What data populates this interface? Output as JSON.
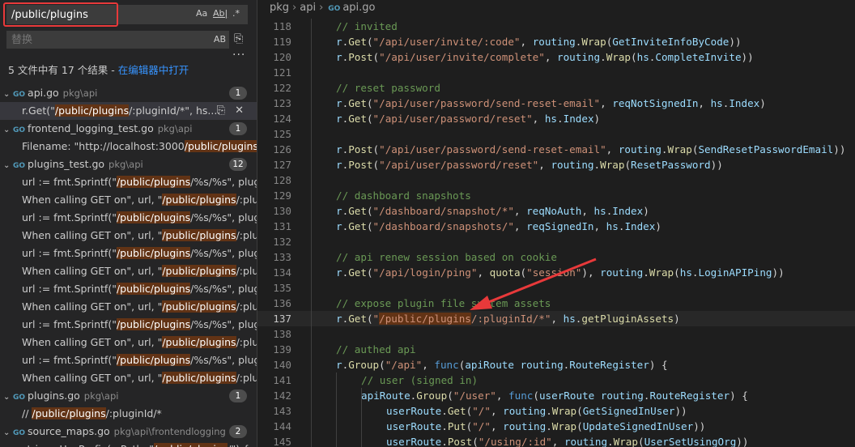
{
  "search": {
    "query": "/public/plugins",
    "replace_placeholder": "替换",
    "summary_prefix": "5 文件中有 17 个结果 - ",
    "summary_link": "在编辑器中打开",
    "opt_case": "Aa",
    "opt_word": "Ab|",
    "opt_regex": ".*",
    "replace_ab": "AB"
  },
  "results": [
    {
      "name": "api.go",
      "path": "pkg\\api",
      "count": "1",
      "matches": [
        {
          "pre": "r.Get(\"",
          "hit": "/public/plugins",
          "post": "/:pluginId/*\", hs...."
        }
      ]
    },
    {
      "name": "frontend_logging_test.go",
      "path": "pkg\\api",
      "count": "1",
      "matches": [
        {
          "pre": "Filename: \"http://localhost:3000",
          "hit": "/public/plugins",
          "post": "/t..."
        }
      ]
    },
    {
      "name": "plugins_test.go",
      "path": "pkg\\api",
      "count": "12",
      "matches": [
        {
          "pre": "url := fmt.Sprintf(\"",
          "hit": "/public/plugins",
          "post": "/%s/%s\", plugi..."
        },
        {
          "pre": "When calling GET on\", url, \"",
          "hit": "/public/plugins",
          "post": "/:plugi..."
        },
        {
          "pre": "url := fmt.Sprintf(\"",
          "hit": "/public/plugins",
          "post": "/%s/%s\", plugi..."
        },
        {
          "pre": "When calling GET on\", url, \"",
          "hit": "/public/plugins",
          "post": "/:plugi..."
        },
        {
          "pre": "url := fmt.Sprintf(\"",
          "hit": "/public/plugins",
          "post": "/%s/%s\", plugi..."
        },
        {
          "pre": "When calling GET on\", url, \"",
          "hit": "/public/plugins",
          "post": "/:plugi..."
        },
        {
          "pre": "url := fmt.Sprintf(\"",
          "hit": "/public/plugins",
          "post": "/%s/%s\", plugi..."
        },
        {
          "pre": "When calling GET on\", url, \"",
          "hit": "/public/plugins",
          "post": "/:plugi..."
        },
        {
          "pre": "url := fmt.Sprintf(\"",
          "hit": "/public/plugins",
          "post": "/%s/%s\", plugi..."
        },
        {
          "pre": "When calling GET on\", url, \"",
          "hit": "/public/plugins",
          "post": "/:plugi..."
        },
        {
          "pre": "url := fmt.Sprintf(\"",
          "hit": "/public/plugins",
          "post": "/%s/%s\", plugi..."
        },
        {
          "pre": "When calling GET on\", url, \"",
          "hit": "/public/plugins",
          "post": "/:plugi..."
        }
      ]
    },
    {
      "name": "plugins.go",
      "path": "pkg\\api",
      "count": "1",
      "matches": [
        {
          "pre": "// ",
          "hit": "/public/plugins",
          "post": "/:pluginId/*"
        }
      ]
    },
    {
      "name": "source_maps.go",
      "path": "pkg\\api\\frontendlogging",
      "count": "2",
      "matches": [
        {
          "pre": "strings.HasPrefix(u.Path, \"",
          "hit": "/public/plugins",
          "post": "/\") {"
        }
      ]
    }
  ],
  "breadcrumb": [
    "pkg",
    "api",
    "api.go"
  ],
  "code": {
    "active_line": 137,
    "lines": [
      {
        "n": "118",
        "indent": 1,
        "tokens": [
          [
            "c",
            "// invited"
          ]
        ]
      },
      {
        "n": "119",
        "indent": 1,
        "tokens": [
          [
            "v",
            "r"
          ],
          [
            "p",
            "."
          ],
          [
            "f",
            "Get"
          ],
          [
            "p",
            "("
          ],
          [
            "s",
            "\"/api/user/invite/:code\""
          ],
          [
            "p",
            ", "
          ],
          [
            "v",
            "routing"
          ],
          [
            "p",
            "."
          ],
          [
            "f",
            "Wrap"
          ],
          [
            "p",
            "("
          ],
          [
            "v",
            "GetInviteInfoByCode"
          ],
          [
            "p",
            "))"
          ]
        ]
      },
      {
        "n": "120",
        "indent": 1,
        "tokens": [
          [
            "v",
            "r"
          ],
          [
            "p",
            "."
          ],
          [
            "f",
            "Post"
          ],
          [
            "p",
            "("
          ],
          [
            "s",
            "\"/api/user/invite/complete\""
          ],
          [
            "p",
            ", "
          ],
          [
            "v",
            "routing"
          ],
          [
            "p",
            "."
          ],
          [
            "f",
            "Wrap"
          ],
          [
            "p",
            "("
          ],
          [
            "v",
            "hs"
          ],
          [
            "p",
            "."
          ],
          [
            "v",
            "CompleteInvite"
          ],
          [
            "p",
            "))"
          ]
        ]
      },
      {
        "n": "121",
        "indent": 0,
        "tokens": []
      },
      {
        "n": "122",
        "indent": 1,
        "tokens": [
          [
            "c",
            "// reset password"
          ]
        ]
      },
      {
        "n": "123",
        "indent": 1,
        "tokens": [
          [
            "v",
            "r"
          ],
          [
            "p",
            "."
          ],
          [
            "f",
            "Get"
          ],
          [
            "p",
            "("
          ],
          [
            "s",
            "\"/api/user/password/send-reset-email\""
          ],
          [
            "p",
            ", "
          ],
          [
            "v",
            "reqNotSignedIn"
          ],
          [
            "p",
            ", "
          ],
          [
            "v",
            "hs"
          ],
          [
            "p",
            "."
          ],
          [
            "v",
            "Index"
          ],
          [
            "p",
            ")"
          ]
        ]
      },
      {
        "n": "124",
        "indent": 1,
        "tokens": [
          [
            "v",
            "r"
          ],
          [
            "p",
            "."
          ],
          [
            "f",
            "Get"
          ],
          [
            "p",
            "("
          ],
          [
            "s",
            "\"/api/user/password/reset\""
          ],
          [
            "p",
            ", "
          ],
          [
            "v",
            "hs"
          ],
          [
            "p",
            "."
          ],
          [
            "v",
            "Index"
          ],
          [
            "p",
            ")"
          ]
        ]
      },
      {
        "n": "125",
        "indent": 0,
        "tokens": []
      },
      {
        "n": "126",
        "indent": 1,
        "tokens": [
          [
            "v",
            "r"
          ],
          [
            "p",
            "."
          ],
          [
            "f",
            "Post"
          ],
          [
            "p",
            "("
          ],
          [
            "s",
            "\"/api/user/password/send-reset-email\""
          ],
          [
            "p",
            ", "
          ],
          [
            "v",
            "routing"
          ],
          [
            "p",
            "."
          ],
          [
            "f",
            "Wrap"
          ],
          [
            "p",
            "("
          ],
          [
            "v",
            "SendResetPasswordEmail"
          ],
          [
            "p",
            "))"
          ]
        ]
      },
      {
        "n": "127",
        "indent": 1,
        "tokens": [
          [
            "v",
            "r"
          ],
          [
            "p",
            "."
          ],
          [
            "f",
            "Post"
          ],
          [
            "p",
            "("
          ],
          [
            "s",
            "\"/api/user/password/reset\""
          ],
          [
            "p",
            ", "
          ],
          [
            "v",
            "routing"
          ],
          [
            "p",
            "."
          ],
          [
            "f",
            "Wrap"
          ],
          [
            "p",
            "("
          ],
          [
            "v",
            "ResetPassword"
          ],
          [
            "p",
            "))"
          ]
        ]
      },
      {
        "n": "128",
        "indent": 0,
        "tokens": []
      },
      {
        "n": "129",
        "indent": 1,
        "tokens": [
          [
            "c",
            "// dashboard snapshots"
          ]
        ]
      },
      {
        "n": "130",
        "indent": 1,
        "tokens": [
          [
            "v",
            "r"
          ],
          [
            "p",
            "."
          ],
          [
            "f",
            "Get"
          ],
          [
            "p",
            "("
          ],
          [
            "s",
            "\"/dashboard/snapshot/*\""
          ],
          [
            "p",
            ", "
          ],
          [
            "v",
            "reqNoAuth"
          ],
          [
            "p",
            ", "
          ],
          [
            "v",
            "hs"
          ],
          [
            "p",
            "."
          ],
          [
            "v",
            "Index"
          ],
          [
            "p",
            ")"
          ]
        ]
      },
      {
        "n": "131",
        "indent": 1,
        "tokens": [
          [
            "v",
            "r"
          ],
          [
            "p",
            "."
          ],
          [
            "f",
            "Get"
          ],
          [
            "p",
            "("
          ],
          [
            "s",
            "\"/dashboard/snapshots/\""
          ],
          [
            "p",
            ", "
          ],
          [
            "v",
            "reqSignedIn"
          ],
          [
            "p",
            ", "
          ],
          [
            "v",
            "hs"
          ],
          [
            "p",
            "."
          ],
          [
            "v",
            "Index"
          ],
          [
            "p",
            ")"
          ]
        ]
      },
      {
        "n": "132",
        "indent": 0,
        "tokens": []
      },
      {
        "n": "133",
        "indent": 1,
        "tokens": [
          [
            "c",
            "// api renew session based on cookie"
          ]
        ]
      },
      {
        "n": "134",
        "indent": 1,
        "tokens": [
          [
            "v",
            "r"
          ],
          [
            "p",
            "."
          ],
          [
            "f",
            "Get"
          ],
          [
            "p",
            "("
          ],
          [
            "s",
            "\"/api/login/ping\""
          ],
          [
            "p",
            ", "
          ],
          [
            "f",
            "quota"
          ],
          [
            "p",
            "("
          ],
          [
            "s",
            "\"session\""
          ],
          [
            "p",
            "), "
          ],
          [
            "v",
            "routing"
          ],
          [
            "p",
            "."
          ],
          [
            "f",
            "Wrap"
          ],
          [
            "p",
            "("
          ],
          [
            "v",
            "hs"
          ],
          [
            "p",
            "."
          ],
          [
            "v",
            "LoginAPIPing"
          ],
          [
            "p",
            "))"
          ]
        ]
      },
      {
        "n": "135",
        "indent": 0,
        "tokens": []
      },
      {
        "n": "136",
        "indent": 1,
        "tokens": [
          [
            "c",
            "// expose plugin file system assets"
          ]
        ]
      },
      {
        "n": "137",
        "indent": 1,
        "tokens": [
          [
            "v",
            "r"
          ],
          [
            "p",
            "."
          ],
          [
            "f",
            "Get"
          ],
          [
            "p",
            "("
          ],
          [
            "s",
            "\""
          ],
          [
            "h",
            "/public/plugins"
          ],
          [
            "s",
            "/:pluginId/*\""
          ],
          [
            "p",
            ", "
          ],
          [
            "v",
            "hs"
          ],
          [
            "p",
            "."
          ],
          [
            "f",
            "getPluginAssets"
          ],
          [
            "p",
            ")"
          ]
        ]
      },
      {
        "n": "138",
        "indent": 0,
        "tokens": []
      },
      {
        "n": "139",
        "indent": 1,
        "tokens": [
          [
            "c",
            "// authed api"
          ]
        ]
      },
      {
        "n": "140",
        "indent": 1,
        "tokens": [
          [
            "v",
            "r"
          ],
          [
            "p",
            "."
          ],
          [
            "f",
            "Group"
          ],
          [
            "p",
            "("
          ],
          [
            "s",
            "\"/api\""
          ],
          [
            "p",
            ", "
          ],
          [
            "k",
            "func"
          ],
          [
            "p",
            "("
          ],
          [
            "v",
            "apiRoute"
          ],
          [
            "p",
            " "
          ],
          [
            "v",
            "routing"
          ],
          [
            "p",
            "."
          ],
          [
            "v",
            "RouteRegister"
          ],
          [
            "p",
            ") {"
          ]
        ]
      },
      {
        "n": "141",
        "indent": 2,
        "tokens": [
          [
            "c",
            "// user (signed in)"
          ]
        ]
      },
      {
        "n": "142",
        "indent": 2,
        "tokens": [
          [
            "v",
            "apiRoute"
          ],
          [
            "p",
            "."
          ],
          [
            "f",
            "Group"
          ],
          [
            "p",
            "("
          ],
          [
            "s",
            "\"/user\""
          ],
          [
            "p",
            ", "
          ],
          [
            "k",
            "func"
          ],
          [
            "p",
            "("
          ],
          [
            "v",
            "userRoute"
          ],
          [
            "p",
            " "
          ],
          [
            "v",
            "routing"
          ],
          [
            "p",
            "."
          ],
          [
            "v",
            "RouteRegister"
          ],
          [
            "p",
            ") {"
          ]
        ]
      },
      {
        "n": "143",
        "indent": 3,
        "tokens": [
          [
            "v",
            "userRoute"
          ],
          [
            "p",
            "."
          ],
          [
            "f",
            "Get"
          ],
          [
            "p",
            "("
          ],
          [
            "s",
            "\"/\""
          ],
          [
            "p",
            ", "
          ],
          [
            "v",
            "routing"
          ],
          [
            "p",
            "."
          ],
          [
            "f",
            "Wrap"
          ],
          [
            "p",
            "("
          ],
          [
            "v",
            "GetSignedInUser"
          ],
          [
            "p",
            "))"
          ]
        ]
      },
      {
        "n": "144",
        "indent": 3,
        "tokens": [
          [
            "v",
            "userRoute"
          ],
          [
            "p",
            "."
          ],
          [
            "f",
            "Put"
          ],
          [
            "p",
            "("
          ],
          [
            "s",
            "\"/\""
          ],
          [
            "p",
            ", "
          ],
          [
            "v",
            "routing"
          ],
          [
            "p",
            "."
          ],
          [
            "f",
            "Wrap"
          ],
          [
            "p",
            "("
          ],
          [
            "v",
            "UpdateSignedInUser"
          ],
          [
            "p",
            "))"
          ]
        ]
      },
      {
        "n": "145",
        "indent": 3,
        "tokens": [
          [
            "v",
            "userRoute"
          ],
          [
            "p",
            "."
          ],
          [
            "f",
            "Post"
          ],
          [
            "p",
            "("
          ],
          [
            "s",
            "\"/using/:id\""
          ],
          [
            "p",
            ", "
          ],
          [
            "v",
            "routing"
          ],
          [
            "p",
            "."
          ],
          [
            "f",
            "Wrap"
          ],
          [
            "p",
            "("
          ],
          [
            "v",
            "UserSetUsingOrg"
          ],
          [
            "p",
            "))"
          ]
        ]
      }
    ]
  },
  "colors": {
    "accent_red": "#e8393a",
    "match_highlight": "#623315",
    "link": "#3794ff"
  }
}
